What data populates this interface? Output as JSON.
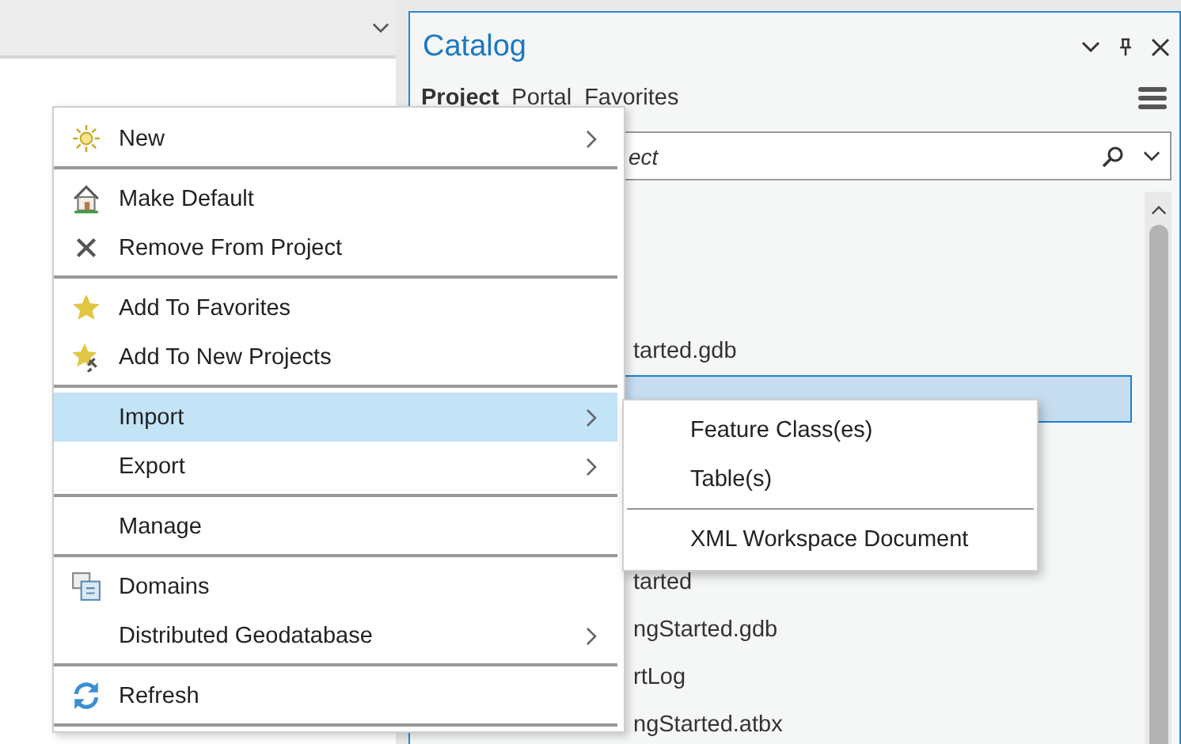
{
  "catalog": {
    "title": "Catalog",
    "tabs": [
      {
        "label": "Project",
        "selected": true
      },
      {
        "label": "Portal",
        "selected": false
      },
      {
        "label": "Favorites",
        "selected": false
      }
    ],
    "search": {
      "placeholder": "ect"
    },
    "items": [
      {
        "label": "tarted.gdb",
        "selected": false
      },
      {
        "selected": true
      },
      {
        "label": "tarted",
        "selected": false
      },
      {
        "label": "ngStarted.gdb",
        "selected": false
      },
      {
        "label": "rtLog",
        "selected": false
      },
      {
        "label": "ngStarted.atbx",
        "selected": false
      }
    ]
  },
  "context_menu": {
    "groups": [
      [
        {
          "label": "New",
          "has_submenu": true,
          "selected": false
        }
      ],
      [
        {
          "label": "Make Default",
          "has_submenu": false,
          "selected": false
        },
        {
          "label": "Remove From Project",
          "has_submenu": false,
          "selected": false
        }
      ],
      [
        {
          "label": "Add To Favorites",
          "has_submenu": false,
          "selected": false
        },
        {
          "label": "Add To New Projects",
          "has_submenu": false,
          "selected": false
        }
      ],
      [
        {
          "label": "Import",
          "has_submenu": true,
          "selected": true
        },
        {
          "label": "Export",
          "has_submenu": true,
          "selected": false
        }
      ],
      [
        {
          "label": "Manage",
          "has_submenu": false,
          "selected": false
        }
      ],
      [
        {
          "label": "Domains",
          "has_submenu": false,
          "selected": false
        },
        {
          "label": "Distributed Geodatabase",
          "has_submenu": true,
          "selected": false
        }
      ],
      [
        {
          "label": "Refresh",
          "has_submenu": false,
          "selected": false
        }
      ]
    ]
  },
  "submenu": {
    "groups": [
      [
        {
          "label": "Feature Class(es)"
        },
        {
          "label": "Table(s)"
        }
      ],
      [
        {
          "label": "XML Workspace Document"
        }
      ]
    ]
  }
}
